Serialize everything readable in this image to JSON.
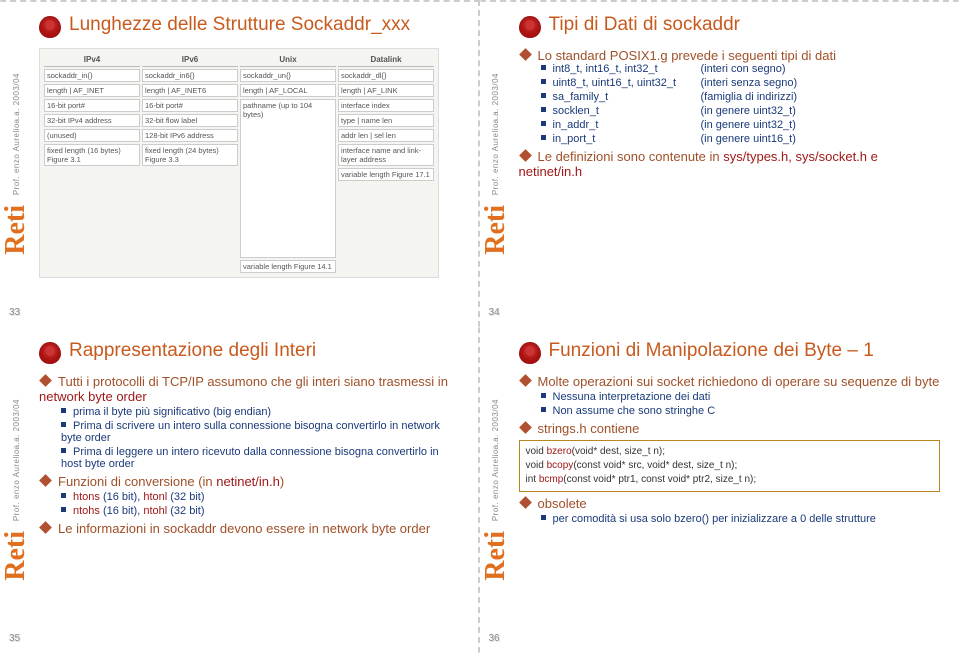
{
  "brand": {
    "year": "a.a. 2003/04",
    "prof": "Prof. enzo Aurelio",
    "label": "Reti"
  },
  "slides": {
    "s33": {
      "num": "33",
      "title": "Lunghezze delle Strutture Sockaddr_xxx",
      "figure": {
        "headers": [
          "IPv4",
          "IPv6",
          "Unix",
          "Datalink"
        ],
        "row_struct": [
          "sockaddr_in{}",
          "sockaddr_in6{}",
          "sockaddr_un{}",
          "sockaddr_dl{}"
        ],
        "row1": [
          "length | AF_INET",
          "length | AF_INET6",
          "length | AF_LOCAL",
          "length | AF_LINK"
        ],
        "row2": [
          "16-bit port#",
          "16-bit port#",
          "",
          "interface index"
        ],
        "row3": [
          "32-bit IPv4 address",
          "32-bit flow label",
          "",
          "type | name len"
        ],
        "row4": [
          "(unused)",
          "128-bit IPv6 address",
          "pathname (up to 104 bytes)",
          "addr len | sel len"
        ],
        "row5": [
          "",
          "",
          "",
          "interface name and link-layer address"
        ],
        "foot": [
          "fixed length (16 bytes) Figure 3.1",
          "fixed length (24 bytes) Figure 3.3",
          "variable length Figure 14.1",
          "variable length Figure 17.1"
        ]
      }
    },
    "s34": {
      "num": "34",
      "title": "Tipi di Dati di sockaddr",
      "bullet1": "Lo standard POSIX1.g prevede i seguenti tipi di dati",
      "rows": [
        {
          "c1": "int8_t, int16_t, int32_t",
          "c2": "(interi con segno)"
        },
        {
          "c1": "uint8_t, uint16_t, uint32_t",
          "c2": "(interi senza segno)"
        },
        {
          "c1": "sa_family_t",
          "c2": "(famiglia di indirizzi)"
        },
        {
          "c1": "socklen_t",
          "c2": "(in genere uint32_t)"
        },
        {
          "c1": "in_addr_t",
          "c2": "(in genere uint32_t)"
        },
        {
          "c1": "in_port_t",
          "c2": "(in genere uint16_t)"
        }
      ],
      "bullet2_pre": "Le definizioni sono contenute in ",
      "bullet2_red": "sys/types.h, sys/socket.h e netinet/in.h"
    },
    "s35": {
      "num": "35",
      "title": "Rappresentazione degli Interi",
      "b1_pre": "Tutti i protocolli di TCP/IP assumono che gli interi siano trasmessi in ",
      "b1_red": "network byte order",
      "sub1": [
        "prima il byte più significativo (big endian)",
        "Prima di scrivere un intero sulla connessione bisogna convertirlo in network byte order",
        "Prima di leggere un intero ricevuto dalla connessione bisogna convertirlo in host byte order"
      ],
      "b2_pre": "Funzioni di conversione (in ",
      "b2_red": "netinet/in.h",
      "b2_post": ")",
      "sub2": [
        {
          "r1": "htons",
          "t1": " (16 bit), ",
          "r2": "htonl",
          "t2": " (32 bit)"
        },
        {
          "r1": "ntohs",
          "t1": " (16 bit), ",
          "r2": "ntohl",
          "t2": " (32 bit)"
        }
      ],
      "b3": "Le informazioni in sockaddr devono essere in network byte order"
    },
    "s36": {
      "num": "36",
      "title": "Funzioni di Manipolazione dei Byte – 1",
      "b1": "Molte operazioni sui socket richiedono di operare su sequenze di byte",
      "sub1": [
        "Nessuna interpretazione dei dati",
        "Non assume che sono stringhe C"
      ],
      "b2": "strings.h contiene",
      "code": [
        {
          "pre": "void ",
          "fn": "bzero",
          "post": "(void* dest, size_t  n);"
        },
        {
          "pre": "void ",
          "fn": "bcopy",
          "post": "(const void* src, void* dest, size_t  n);"
        },
        {
          "pre": "int ",
          "fn": "bcmp",
          "post": "(const void* ptr1, const void* ptr2, size_t  n);"
        }
      ],
      "b3": "obsolete",
      "sub3": "per comodità si usa solo bzero() per inizializzare a 0 delle strutture"
    }
  }
}
